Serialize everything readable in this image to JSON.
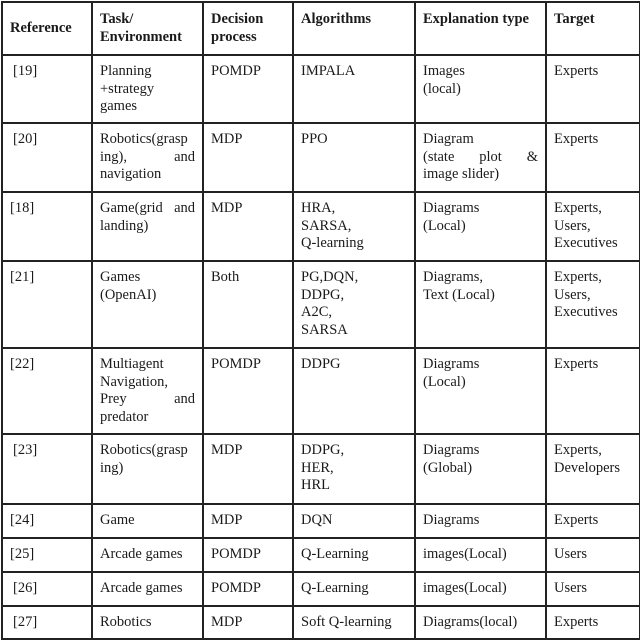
{
  "table": {
    "headers": {
      "reference": "Reference",
      "task": [
        "Task/",
        "Environment"
      ],
      "decision": [
        "Decision",
        "process"
      ],
      "algorithms": "Algorithms",
      "explanation": "Explanation type",
      "target": "Target"
    },
    "rows": [
      {
        "reference": "[19]",
        "task": [
          "Planning",
          "+strategy",
          "games"
        ],
        "decision": "POMDP",
        "algorithms": [
          "IMPALA"
        ],
        "explanation": [
          "Images",
          "(local)"
        ],
        "target": [
          "Experts"
        ]
      },
      {
        "reference": "[20]",
        "task": [
          "Robotics(grasp",
          "ing),|and",
          "navigation"
        ],
        "decision": "MDP",
        "algorithms": [
          "PPO"
        ],
        "explanation": [
          "Diagram",
          "(state|plot|&",
          "image slider)"
        ],
        "target": [
          "Experts"
        ]
      },
      {
        "reference": "[18]",
        "task": [
          "Game(grid|and",
          "landing)"
        ],
        "decision": "MDP",
        "algorithms": [
          "HRA,",
          "SARSA,",
          "Q-learning"
        ],
        "explanation": [
          "Diagrams",
          "(Local)"
        ],
        "target": [
          "Experts,",
          "Users,",
          "Executives"
        ]
      },
      {
        "reference": "[21]",
        "task": [
          "Games",
          "(OpenAI)"
        ],
        "decision": "Both",
        "algorithms": [
          "PG,DQN,",
          "DDPG,",
          "A2C,",
          "SARSA"
        ],
        "explanation": [
          "Diagrams,",
          "Text (Local)"
        ],
        "target": [
          "Experts,",
          "Users,",
          "Executives"
        ]
      },
      {
        "reference": "[22]",
        "task": [
          "Multiagent",
          "Navigation,",
          "Prey|and",
          "predator"
        ],
        "decision": "POMDP",
        "algorithms": [
          "DDPG"
        ],
        "explanation": [
          "Diagrams",
          "(Local)"
        ],
        "target": [
          "Experts"
        ]
      },
      {
        "reference": "[23]",
        "task": [
          "Robotics(grasp",
          "ing)"
        ],
        "decision": "MDP",
        "algorithms": [
          "DDPG,",
          "HER,",
          "HRL"
        ],
        "explanation": [
          "Diagrams",
          "(Global)"
        ],
        "target": [
          "Experts,",
          "Developers"
        ]
      },
      {
        "reference": "[24]",
        "task": [
          "Game"
        ],
        "decision": "MDP",
        "algorithms": [
          "DQN"
        ],
        "explanation": [
          "Diagrams"
        ],
        "target": [
          "Experts"
        ]
      },
      {
        "reference": "[25]",
        "task": [
          "Arcade games"
        ],
        "decision": "POMDP",
        "algorithms": [
          "Q-Learning"
        ],
        "explanation": [
          "images(Local)"
        ],
        "target": [
          "Users"
        ]
      },
      {
        "reference": "[26]",
        "task": [
          "Arcade games"
        ],
        "decision": "POMDP",
        "algorithms": [
          "Q-Learning"
        ],
        "explanation": [
          "images(Local)"
        ],
        "target": [
          "Users"
        ]
      },
      {
        "reference": "[27]",
        "task": [
          "Robotics"
        ],
        "decision": "MDP",
        "algorithms": [
          "Soft Q-learning"
        ],
        "explanation": [
          "Diagrams(local)"
        ],
        "target": [
          "Experts"
        ]
      }
    ]
  }
}
